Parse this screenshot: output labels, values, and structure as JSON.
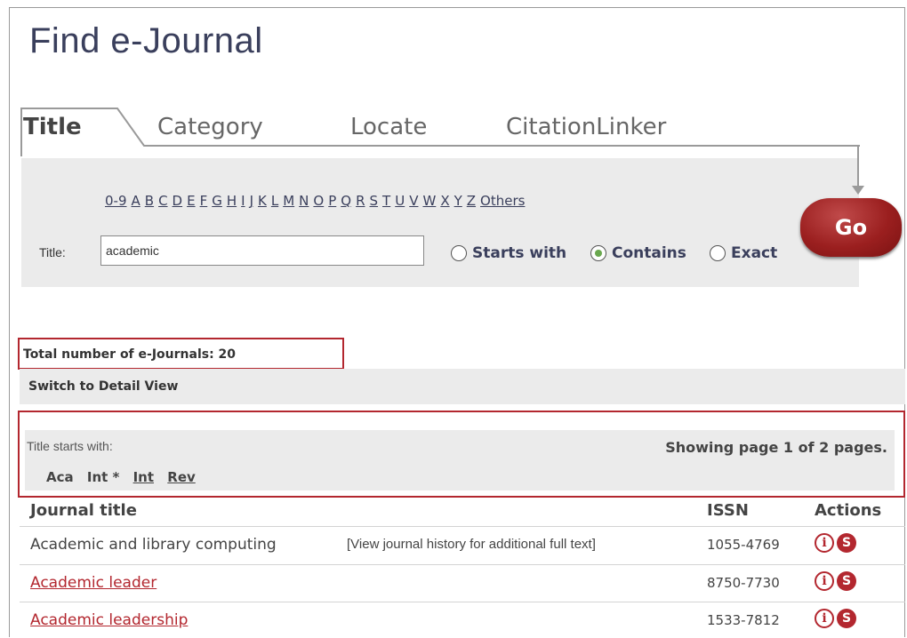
{
  "page_title": "Find e-Journal",
  "tabs": [
    {
      "label": "Title",
      "active": true
    },
    {
      "label": "Category",
      "active": false
    },
    {
      "label": "Locate",
      "active": false
    },
    {
      "label": "CitationLinker",
      "active": false
    }
  ],
  "letters": [
    "0-9",
    "A",
    "B",
    "C",
    "D",
    "E",
    "F",
    "G",
    "H",
    "I",
    "J",
    "K",
    "L",
    "M",
    "N",
    "O",
    "P",
    "Q",
    "R",
    "S",
    "T",
    "U",
    "V",
    "W",
    "X",
    "Y",
    "Z",
    "Others"
  ],
  "search": {
    "label": "Title:",
    "value": "academic"
  },
  "match_options": [
    {
      "label": "Starts with",
      "selected": false
    },
    {
      "label": "Contains",
      "selected": true
    },
    {
      "label": "Exact",
      "selected": false
    }
  ],
  "go_label": "Go",
  "total_text": "Total number of e-Journals: 20",
  "switch_view": "Switch to Detail View",
  "title_starts_with": "Title starts with:",
  "paging": "Showing page 1 of 2 pages.",
  "prefixes": [
    {
      "label": "Aca",
      "link": false
    },
    {
      "label": "Int *",
      "link": false
    },
    {
      "label": "Int",
      "link": true
    },
    {
      "label": "Rev",
      "link": true
    }
  ],
  "columns": {
    "title": "Journal title",
    "issn": "ISSN",
    "actions": "Actions"
  },
  "rows": [
    {
      "title": "Academic and library computing",
      "history": "[View journal history for additional full text]",
      "issn": "1055-4769",
      "link": false
    },
    {
      "title": "Academic leader",
      "history": "",
      "issn": "8750-7730",
      "link": true
    },
    {
      "title": "Academic leadership",
      "history": "",
      "issn": "1533-7812",
      "link": true
    }
  ],
  "colors": {
    "accent": "#b3272f",
    "panel": "#ebebeb",
    "heading": "#3a3f5c"
  }
}
